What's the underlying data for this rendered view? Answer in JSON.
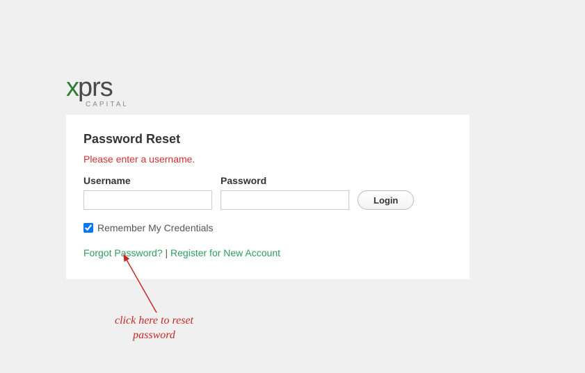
{
  "logo": {
    "x": "x",
    "prs": "prs",
    "sub": "CAPITAL"
  },
  "panel": {
    "title": "Password Reset",
    "error": "Please enter a username.",
    "username_label": "Username",
    "username_value": "",
    "password_label": "Password",
    "password_value": "",
    "login_label": "Login",
    "remember_label": "Remember My Credentials",
    "remember_checked": true,
    "forgot_label": "Forgot Password?",
    "separator": " | ",
    "register_label": "Register for New Account"
  },
  "annotation": {
    "line1": "click here to reset",
    "line2": "password"
  }
}
